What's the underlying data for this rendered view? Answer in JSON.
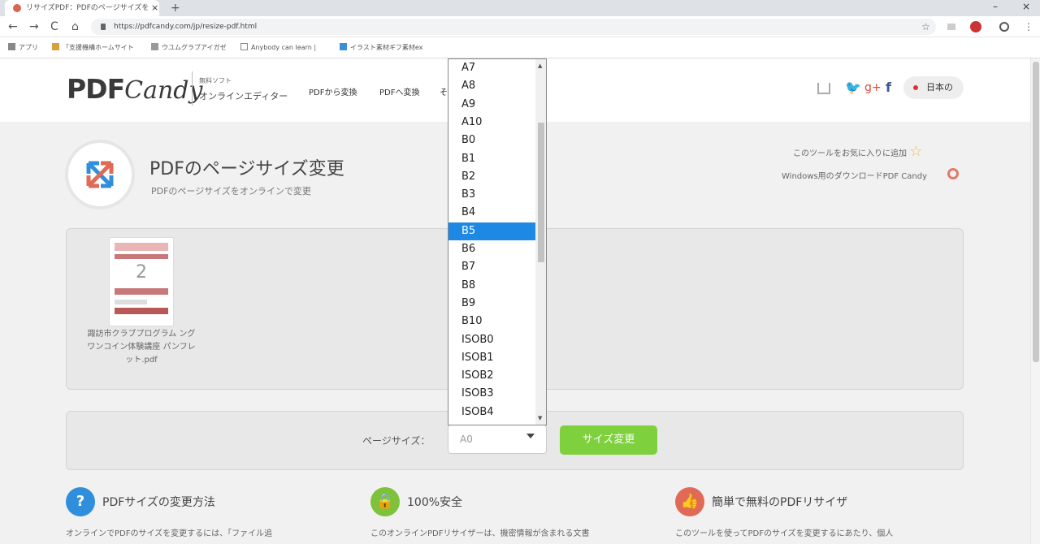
{
  "browser": {
    "tab_title": "リサイズPDF：PDFのページサイズを",
    "tab_close": "×",
    "new_tab": "+",
    "url": "https://pdfcandy.com/jp/resize-pdf.html",
    "bookmarks": [
      "アプリ",
      "「支援機構ホームサイト",
      "ウユムグラブアイガゼ",
      "Anybody can learn |",
      "イラスト素材ギフ素材ex"
    ],
    "back": "←",
    "forward": "→",
    "reload": "C",
    "home": "⌂",
    "star": "☆",
    "menu": "⋮",
    "minimize": "–",
    "close": "×"
  },
  "header": {
    "logo_bold": "PDF",
    "logo_italic": "Candy",
    "tagline_small": "無料ソフト",
    "tagline": "オンラインエディター",
    "nav": [
      "PDFから変換",
      "PDFへ変換",
      "その他"
    ],
    "language": "日本の"
  },
  "hero": {
    "title": "PDFのページサイズ変更",
    "subtitle": "PDFのページサイズをオンラインで変更",
    "favorite": "このツールをお気に入りに追加",
    "windows": "Windows用のダウンロードPDF Candy"
  },
  "file": {
    "page_num": "2",
    "name": "諏訪市クラブプログラム ングワンコイン体験講座 パンフレット.pdf"
  },
  "options": {
    "label": "ページサイズ：",
    "current_value": "A0",
    "button": "サイズ変更"
  },
  "dropdown": {
    "options": [
      "A7",
      "A8",
      "A9",
      "A10",
      "B0",
      "B1",
      "B2",
      "B3",
      "B4",
      "B5",
      "B6",
      "B7",
      "B8",
      "B9",
      "B10",
      "ISOB0",
      "ISOB1",
      "ISOB2",
      "ISOB3",
      "ISOB4"
    ],
    "selected": "B5"
  },
  "features": [
    {
      "title": "PDFサイズの変更方法",
      "text": "オンラインでPDFのサイズを変更するには、「ファイル追",
      "color": "#2f8fdc",
      "icon": "?"
    },
    {
      "title": "100%安全",
      "text": "このオンラインPDFリサイザーは、機密情報が含まれる文書",
      "color": "#7ec13a",
      "icon": "🔒"
    },
    {
      "title": "簡単で無料のPDFリサイザ",
      "text": "このツールを使ってPDFのサイズを変更するにあたり、個人",
      "color": "#e06a55",
      "icon": "👍"
    }
  ],
  "colors": {
    "accent_green": "#7ed13c",
    "selection_blue": "#1e88e5"
  }
}
